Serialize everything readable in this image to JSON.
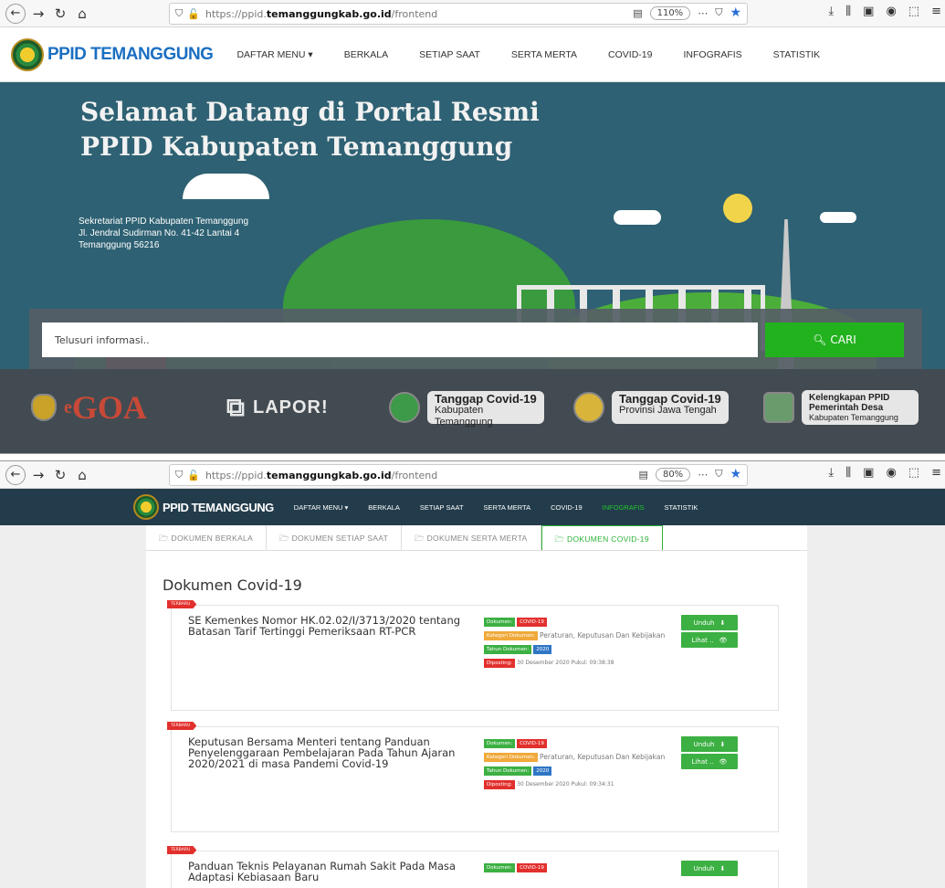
{
  "browser": {
    "url_prefix": "https://ppid.",
    "url_domain": "temanggungkab.go.id",
    "url_path": "/frontend",
    "zoom_top": "110%",
    "zoom_bottom": "80%",
    "menu_icon": "⋯"
  },
  "site": {
    "logo_text": "PPID TEMANGGUNG",
    "nav": [
      "DAFTAR MENU ▾",
      "BERKALA",
      "SETIAP SAAT",
      "SERTA MERTA",
      "COVID-19",
      "INFOGRAFIS",
      "STATISTIK"
    ]
  },
  "hero": {
    "title_line1": "Selamat Datang di Portal Resmi",
    "title_line2": "PPID Kabupaten Temanggung",
    "address_line1": "Sekretariat PPID Kabupaten Temanggung",
    "address_line2": "Jl. Jendral Sudirman No. 41-42 Lantai 4",
    "address_line3": "Temanggung 56216"
  },
  "search": {
    "placeholder": "Telusuri informasi..",
    "button": "CARI"
  },
  "links": {
    "goa": "GOA",
    "goa_prefix": "e",
    "lapor": "LAPOR!",
    "covid_kab_title": "Tanggap Covid-19",
    "covid_kab_sub": "Kabupaten Temanggung",
    "covid_prov_title": "Tanggap Covid-19",
    "covid_prov_sub": "Provinsi Jawa Tengah",
    "desa_line1": "Kelengkapan PPID",
    "desa_line2": "Pemerintah Desa",
    "desa_line3": "Kabupaten Temanggung"
  },
  "tabs": [
    "DOKUMEN BERKALA",
    "DOKUMEN SETIAP SAAT",
    "DOKUMEN SERTA MERTA",
    "DOKUMEN COVID-19"
  ],
  "section_title": "Dokumen Covid-19",
  "labels": {
    "ribbon": "TERBARU",
    "dokumen": "Dokumen:",
    "kategori": "Kategori Dokumen:",
    "tahun": "Tahun Dokumen:",
    "diposting": "Diposting:",
    "unduh": "Unduh",
    "lihat": "Lihat .."
  },
  "documents": [
    {
      "title": "SE Kemenkes Nomor HK.02.02/I/3713/2020 tentang Batasan Tarif Tertinggi Pemeriksaan RT-PCR",
      "dokumen": "COVID-19",
      "kategori": "Peraturan, Keputusan Dan Kebijakan",
      "tahun": "2020",
      "diposting": "30 Desember 2020 Pukul: 09:38:38"
    },
    {
      "title": "Keputusan Bersama Menteri tentang Panduan Penyelenggaraan Pembelajaran Pada Tahun Ajaran 2020/2021 di masa Pandemi Covid-19",
      "dokumen": "COVID-19",
      "kategori": "Peraturan, Keputusan Dan Kebijakan",
      "tahun": "2020",
      "diposting": "30 Desember 2020 Pukul: 09:34:31"
    },
    {
      "title": "Panduan Teknis Pelayanan Rumah Sakit Pada Masa Adaptasi Kebiasaan Baru",
      "dokumen": "COVID-19"
    }
  ],
  "colors": {
    "green": "#3cb043",
    "red": "#e2302d",
    "nav_dark": "#233c4b",
    "hero_bg": "#2e6173"
  }
}
